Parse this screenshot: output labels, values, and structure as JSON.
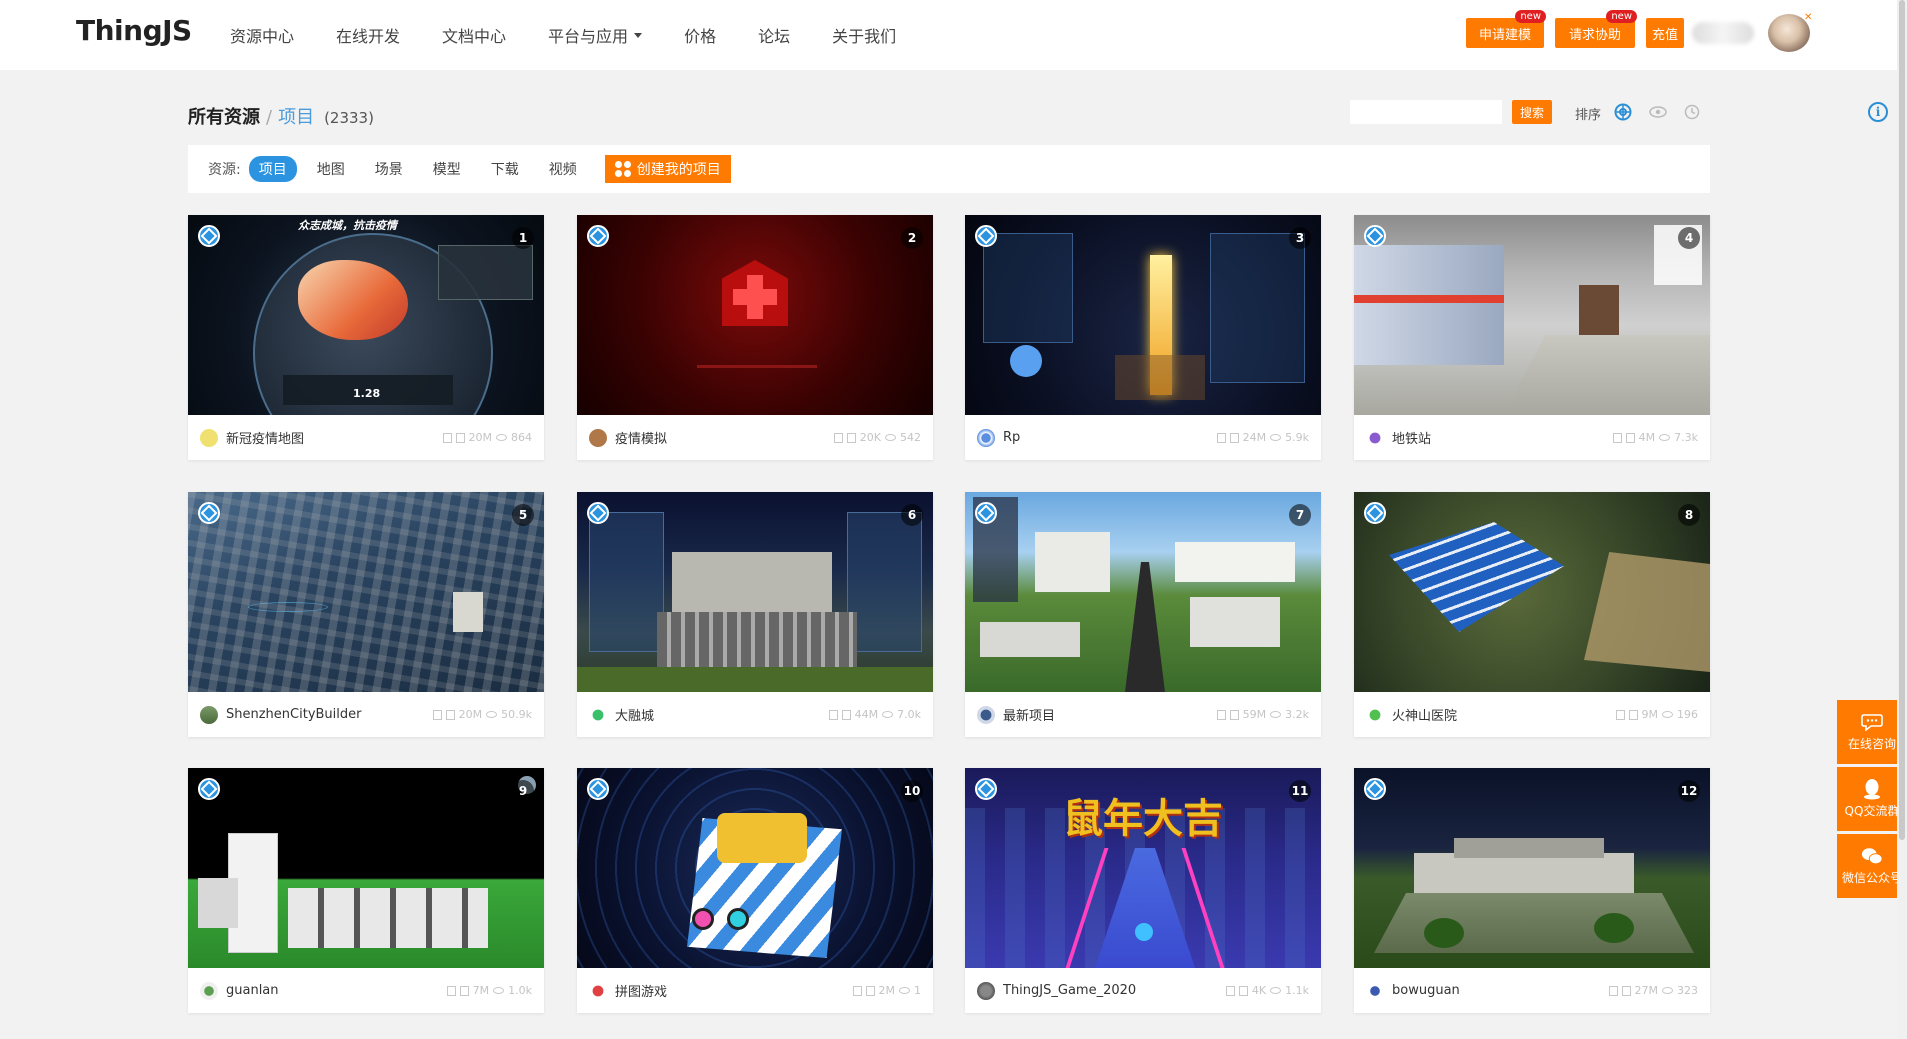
{
  "header": {
    "logo": "ThingJS",
    "nav": [
      {
        "label": "资源中心"
      },
      {
        "label": "在线开发"
      },
      {
        "label": "文档中心"
      },
      {
        "label": "平台与应用"
      },
      {
        "label": "价格"
      },
      {
        "label": "论坛"
      },
      {
        "label": "关于我们"
      }
    ],
    "apply_model_label": "申请建模",
    "request_help_label": "请求协助",
    "recharge_label": "充值",
    "new_badge": "new"
  },
  "breadcrumb": {
    "all": "所有资源",
    "separator": "/",
    "current": "项目",
    "count": "(2333)"
  },
  "toolbar": {
    "search_placeholder": "",
    "search_label": "搜索",
    "sort_label": "排序"
  },
  "filter": {
    "label": "资源:",
    "chips": [
      {
        "label": "项目",
        "active": true
      },
      {
        "label": "地图",
        "active": false
      },
      {
        "label": "场景",
        "active": false
      },
      {
        "label": "模型",
        "active": false
      },
      {
        "label": "下载",
        "active": false
      },
      {
        "label": "视频",
        "active": false
      }
    ],
    "create_label": "创建我的项目"
  },
  "projects": [
    {
      "rank": "1",
      "name": "新冠疫情地图",
      "size": "20M",
      "views": "864",
      "thumb_title": "众志成城，抗击疫情"
    },
    {
      "rank": "2",
      "name": "疫情模拟",
      "size": "20K",
      "views": "542"
    },
    {
      "rank": "3",
      "name": "Rp",
      "size": "24M",
      "views": "5.9k"
    },
    {
      "rank": "4",
      "name": "地铁站",
      "size": "4M",
      "views": "7.3k"
    },
    {
      "rank": "5",
      "name": "ShenzhenCityBuilder",
      "size": "20M",
      "views": "50.9k"
    },
    {
      "rank": "6",
      "name": "大融城",
      "size": "44M",
      "views": "7.0k"
    },
    {
      "rank": "7",
      "name": "最新项目",
      "size": "59M",
      "views": "3.2k"
    },
    {
      "rank": "8",
      "name": "火神山医院",
      "size": "9M",
      "views": "196"
    },
    {
      "rank": "9",
      "name": "guanlan",
      "size": "7M",
      "views": "1.0k"
    },
    {
      "rank": "10",
      "name": "拼图游戏",
      "size": "2M",
      "views": "1"
    },
    {
      "rank": "11",
      "name": "ThingJS_Game_2020",
      "size": "4K",
      "views": "1.1k",
      "thumb_title": "鼠年大吉"
    },
    {
      "rank": "12",
      "name": "bowuguan",
      "size": "27M",
      "views": "323"
    }
  ],
  "side": {
    "consult_label": "在线咨询",
    "qq_label": "QQ交流群",
    "wechat_label": "微信公众号"
  },
  "colors": {
    "accent": "#ff7a00",
    "primary": "#2b93e0"
  }
}
